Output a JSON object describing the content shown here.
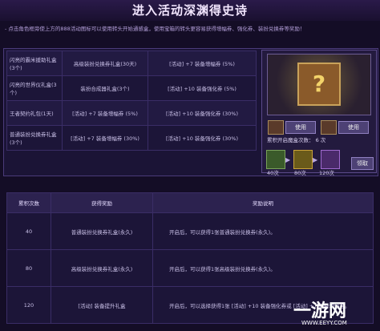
{
  "header": {
    "title": "进入活动深渊得史诗"
  },
  "notice": "- 点击角色框旁使上方的888活动图标可以使用转头开始通感盒，使用宝箱的转头更容易获得增幅券、强化券、装扮兑换券等奖励！",
  "rewards": [
    {
      "name": "闪亮的霸米援助礼盒(3个)",
      "item1": "高级装扮兑换券礼盒(30天)",
      "item2": "[活动] +7 装备增幅券 (5%)"
    },
    {
      "name": "闪亮的世界仪礼盒(3个)",
      "item1": "装扮合成器礼盒(3个)",
      "item2": "[活动] +10 装备强化券 (5%)"
    },
    {
      "name": "王者契约礼包(1天)",
      "item1": "[活动] +7 装备增幅券 (5%)",
      "item2": "[活动] +10 装备强化券 (30%)"
    },
    {
      "name": "普通装扮兑换券礼盒(3个)",
      "item1": "[活动] +7 装备增幅券 (30%)",
      "item2": "[活动] +10 装备强化券 (30%)"
    }
  ],
  "panel": {
    "use_label": "使用",
    "count_label": "累积开启魔盒次数：",
    "count_value": "6 次",
    "tiers": [
      "40次",
      "80次",
      "120次"
    ],
    "claim_label": "领取"
  },
  "bottom": {
    "headers": [
      "累积次数",
      "获得奖励",
      "奖励说明"
    ],
    "rows": [
      {
        "n": "40",
        "reward": "普通装扮兑换券礼盒(永久)",
        "desc": "开启后，可以获得1张普通装扮兑换券(永久)。"
      },
      {
        "n": "80",
        "reward": "高级装扮兑换券礼盒(永久)",
        "desc": "开启后，可以获得1张高级装扮兑换券(永久)。"
      },
      {
        "n": "120",
        "reward": "[活动] 装备提升礼盒",
        "desc": "开启后，可以选择获得1张 [活动] +10 装备强化券或 [活动] +7 装备增幅券。"
      }
    ]
  },
  "watermark": {
    "brand": "一游网",
    "url": "WWW.EEYY.COM"
  },
  "colors": {
    "background": "#140d26",
    "accent": "#8f7fc0"
  }
}
